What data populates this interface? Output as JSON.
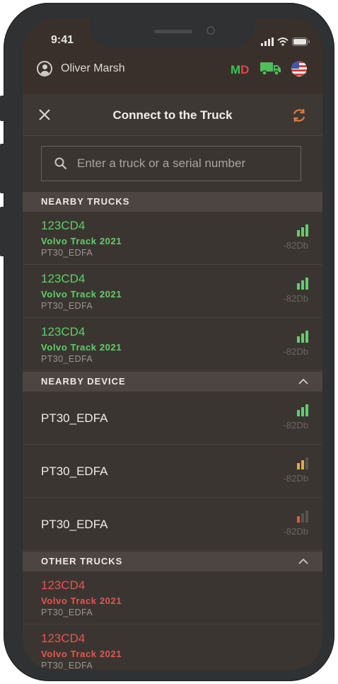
{
  "status_bar": {
    "time": "9:41"
  },
  "top_bar": {
    "user_name": "Oliver Marsh",
    "md_m": "M",
    "md_d": "D"
  },
  "header": {
    "title": "Connect to the Truck"
  },
  "search": {
    "placeholder": "Enter a truck or a serial number"
  },
  "sections": {
    "nearby_trucks": "NEARBY TRUCKS",
    "nearby_device": "NEARBY DEVICE",
    "other_trucks": "OTHER TRUCKS"
  },
  "nearby_trucks": [
    {
      "id": "123CD4",
      "model": "Volvo Track 2021",
      "serial": "PT30_EDFA",
      "db": "-82Db",
      "signal": 3,
      "signal_color": "#5fd068"
    },
    {
      "id": "123CD4",
      "model": "Volvo Track 2021",
      "serial": "PT30_EDFA",
      "db": "-82Db",
      "signal": 3,
      "signal_color": "#5fd068"
    },
    {
      "id": "123CD4",
      "model": "Volvo Track 2021",
      "serial": "PT30_EDFA",
      "db": "-82Db",
      "signal": 3,
      "signal_color": "#5fd068"
    }
  ],
  "nearby_devices": [
    {
      "name": "PT30_EDFA",
      "db": "-82Db",
      "signal": 3,
      "signal_color": "#5fd068"
    },
    {
      "name": "PT30_EDFA",
      "db": "-82Db",
      "signal": 2,
      "signal_color": "#e8a83a"
    },
    {
      "name": "PT30_EDFA",
      "db": "-82Db",
      "signal": 1,
      "signal_color": "#e65550"
    }
  ],
  "other_trucks": [
    {
      "id": "123CD4",
      "model": "Volvo Track 2021",
      "serial": "PT30_EDFA"
    },
    {
      "id": "123CD4",
      "model": "Volvo Track 2021",
      "serial": "PT30_EDFA"
    }
  ],
  "colors": {
    "accent_green": "#5fd068",
    "accent_red": "#e65550",
    "refresh_orange": "#e07a3a",
    "background": "#3b3532"
  },
  "icons": [
    "user-icon",
    "truck-icon",
    "us-flag-icon",
    "close-icon",
    "refresh-icon",
    "search-icon",
    "signal-icon",
    "chevron-up-icon"
  ]
}
